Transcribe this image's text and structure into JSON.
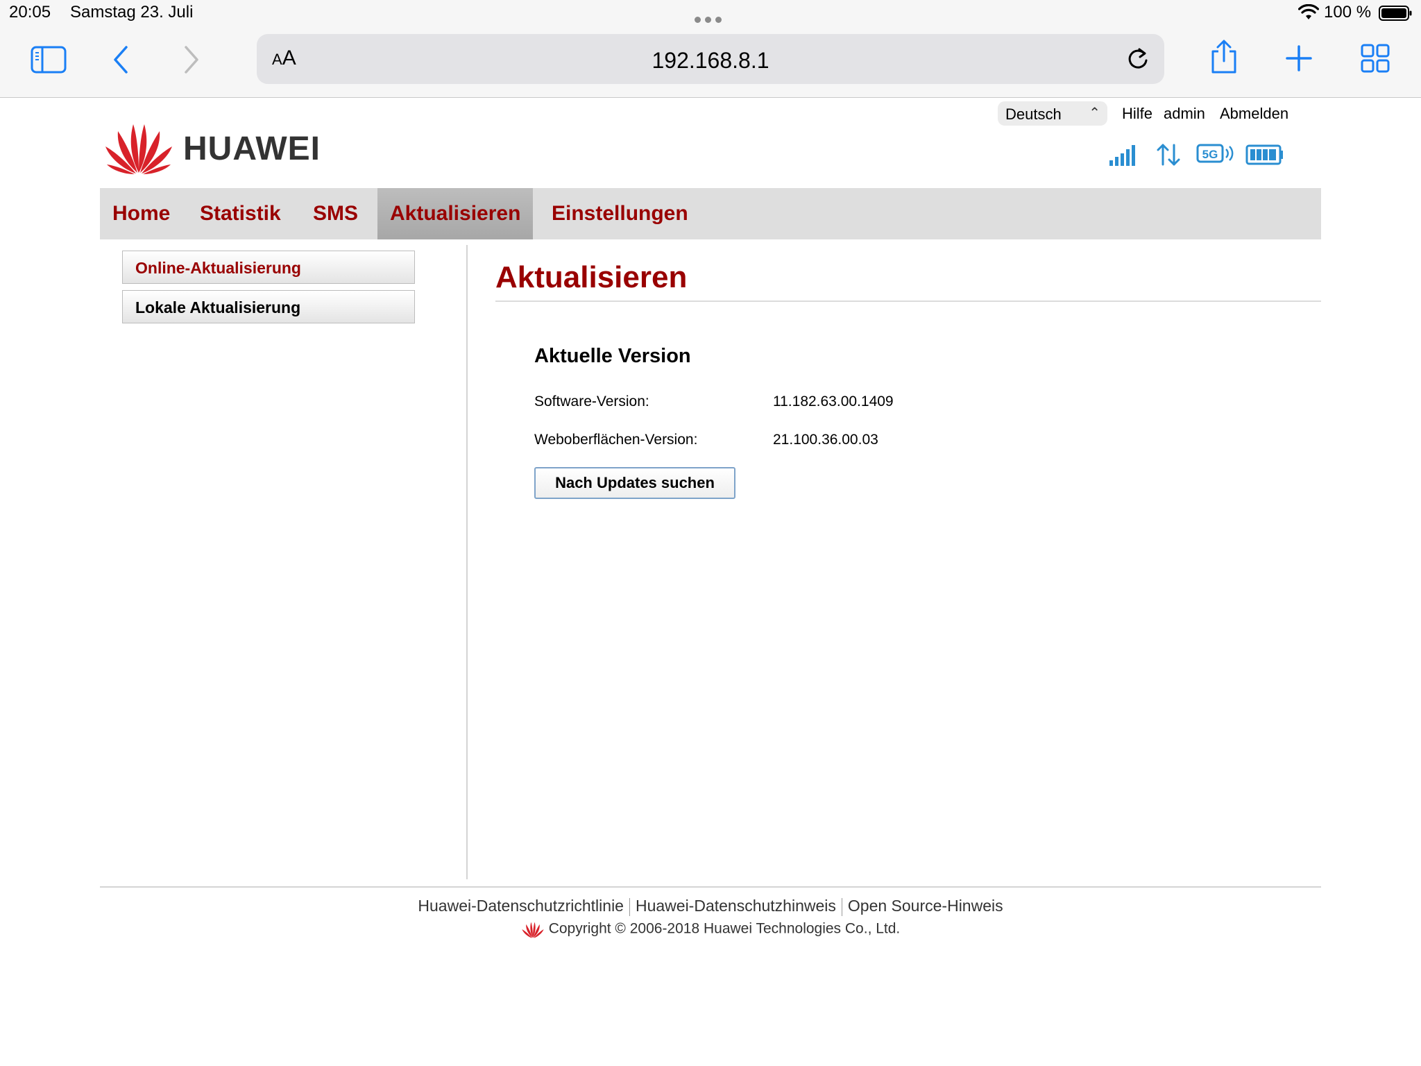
{
  "status_bar": {
    "time": "20:05",
    "date": "Samstag 23. Juli",
    "battery": "100 %"
  },
  "browser": {
    "reader_label_small": "A",
    "reader_label_large": "A",
    "url": "192.168.8.1"
  },
  "header": {
    "brand": "HUAWEI",
    "language": "Deutsch",
    "links": {
      "help": "Hilfe",
      "user": "admin",
      "logout": "Abmelden"
    }
  },
  "nav": {
    "items": [
      {
        "label": "Home"
      },
      {
        "label": "Statistik"
      },
      {
        "label": "SMS"
      },
      {
        "label": "Aktualisieren"
      },
      {
        "label": "Einstellungen"
      }
    ],
    "active": "Aktualisieren"
  },
  "sidebar": {
    "items": [
      {
        "label": "Online-Aktualisierung",
        "selected": true
      },
      {
        "label": "Lokale Aktualisierung",
        "selected": false
      }
    ]
  },
  "main": {
    "title": "Aktualisieren",
    "section_title": "Aktuelle Version",
    "rows": [
      {
        "label": "Software-Version:",
        "value": "11.182.63.00.1409"
      },
      {
        "label": "Weboberflächen-Version:",
        "value": "21.100.36.00.03"
      }
    ],
    "check_button": "Nach Updates suchen"
  },
  "footer": {
    "links": [
      "Huawei-Datenschutzrichtlinie",
      "Huawei-Datenschutzhinweis",
      "Open Source-Hinweis"
    ],
    "copyright": "Copyright © 2006-2018 Huawei Technologies Co., Ltd."
  },
  "colors": {
    "accent": "#990000",
    "ios_blue": "#1a7ff5",
    "status_blue": "#2a8ed1"
  },
  "icons": {
    "status": [
      "signal-strength-icon",
      "data-transfer-icon",
      "5g-network-icon",
      "battery-full-icon"
    ]
  }
}
